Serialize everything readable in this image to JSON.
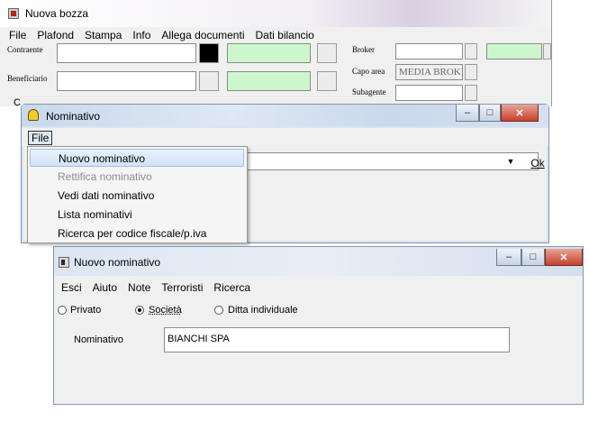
{
  "bozza": {
    "title": "Nuova bozza",
    "menu": [
      "File",
      "Plafond",
      "Stampa",
      "Info",
      "Allega documenti",
      "Dati bilancio"
    ],
    "labels": {
      "contraente": "Contraente",
      "beneficiario": "Beneficiario",
      "broker": "Broker",
      "capo_area": "Capo area",
      "subagente": "Subagente"
    },
    "capo_area_value": "MEDIA BROKE",
    "bg_label": "C"
  },
  "nominativo": {
    "title": "Nominativo",
    "menu_file": "File",
    "ok_label": "Ok",
    "dropdown_items": [
      "Nuovo nominativo",
      "Rettifica nominativo",
      "Vedi dati nominativo",
      "Lista nominativi",
      "Ricerca per codice fiscale/p.iva"
    ]
  },
  "nuovo": {
    "title": "Nuovo nominativo",
    "menu": [
      "Esci",
      "Aiuto",
      "Note",
      "Terroristi",
      "Ricerca"
    ],
    "radio_privato": "Privato",
    "radio_societa": "Società",
    "radio_ditta": "Ditta individuale",
    "nominativo_label": "Nominativo",
    "nominativo_value": "BIANCHI SPA"
  },
  "colors": {
    "green_field": "#ccf7cc",
    "title_bar": "#c9d8ec",
    "close_button": "#c5412b"
  }
}
